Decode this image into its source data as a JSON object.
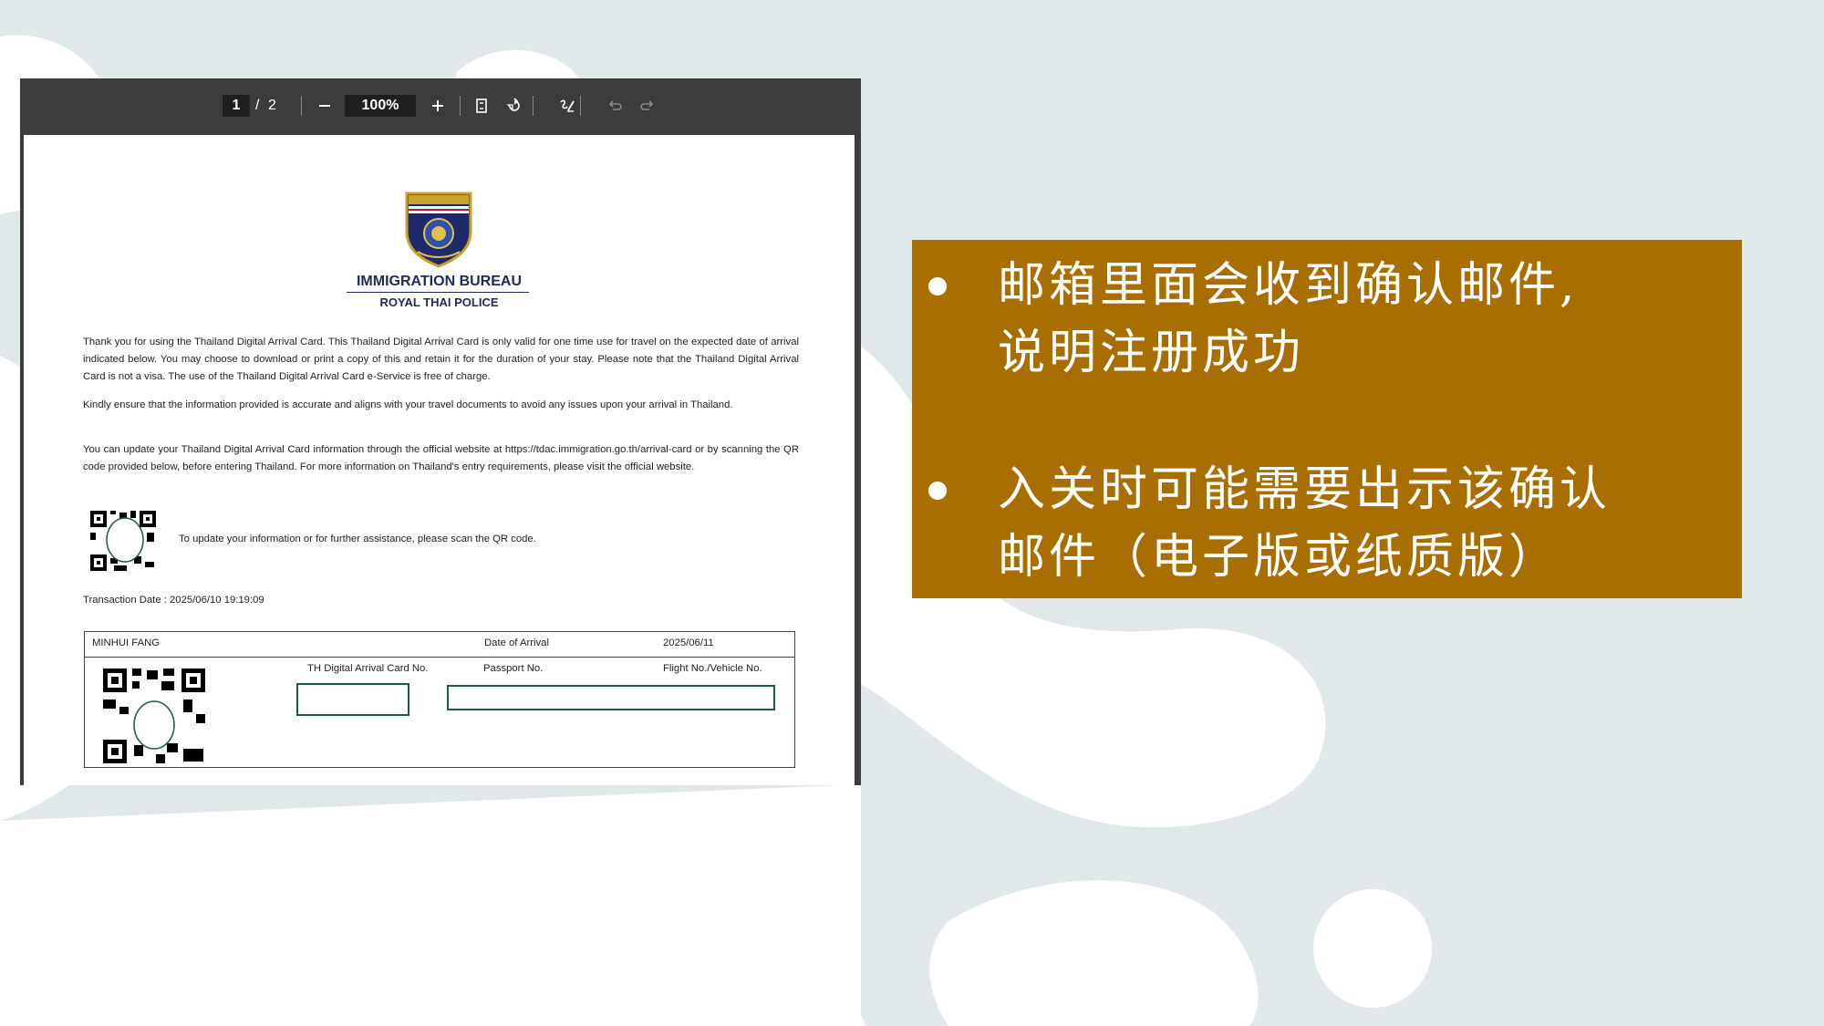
{
  "viewer": {
    "page_current": "1",
    "page_separator": "/",
    "page_total": "2",
    "zoom": "100%",
    "icons": {
      "zoom_out": "minus-icon",
      "zoom_in": "plus-icon",
      "fit_page": "fit-page-icon",
      "rotate": "rotate-icon",
      "draw": "draw-icon",
      "undo": "undo-icon",
      "redo": "redo-icon"
    }
  },
  "document": {
    "title": "IMMIGRATION BUREAU",
    "subtitle": "ROYAL THAI POLICE",
    "logo": "royal-thai-police-emblem",
    "paragraphs": [
      "Thank you for using the Thailand Digital Arrival Card. This Thailand Digital Arrival Card is only valid for one time use for travel on the expected date of arrival indicated below. You may choose to download or print a copy of this and retain it for the duration of your stay. Please note that the Thailand Digital Arrival Card is not a visa. The use of the Thailand Digital Arrival Card e-Service is free of charge.",
      "Kindly ensure that the information provided is accurate and aligns with your travel documents to avoid any issues upon your arrival in Thailand.",
      "You can update your Thailand Digital Arrival Card information through the official website at https://tdac.immigration.go.th/arrival-card or by scanning the QR code provided below, before entering Thailand. For more information on Thailand's entry requirements, please visit the official website."
    ],
    "qr_note": "To update your information or for further assistance, please scan the QR code.",
    "transaction": "Transaction Date : 2025/06/10 19:19:09",
    "card": {
      "name": "MINHUI FANG",
      "date_label": "Date of Arrival",
      "date_value": "2025/06/11",
      "tdac_label": "TH Digital Arrival Card No.",
      "passport_label": "Passport No.",
      "flight_label": "Flight No./Vehicle No."
    }
  },
  "panel": {
    "bg_color": "#a96e00",
    "bullets": [
      {
        "line1": "邮箱里面会收到确认邮件,",
        "line2": "说明注册成功"
      },
      {
        "line1": "入关时可能需要出示该确认",
        "line2": "邮件（电子版或纸质版）"
      }
    ]
  }
}
